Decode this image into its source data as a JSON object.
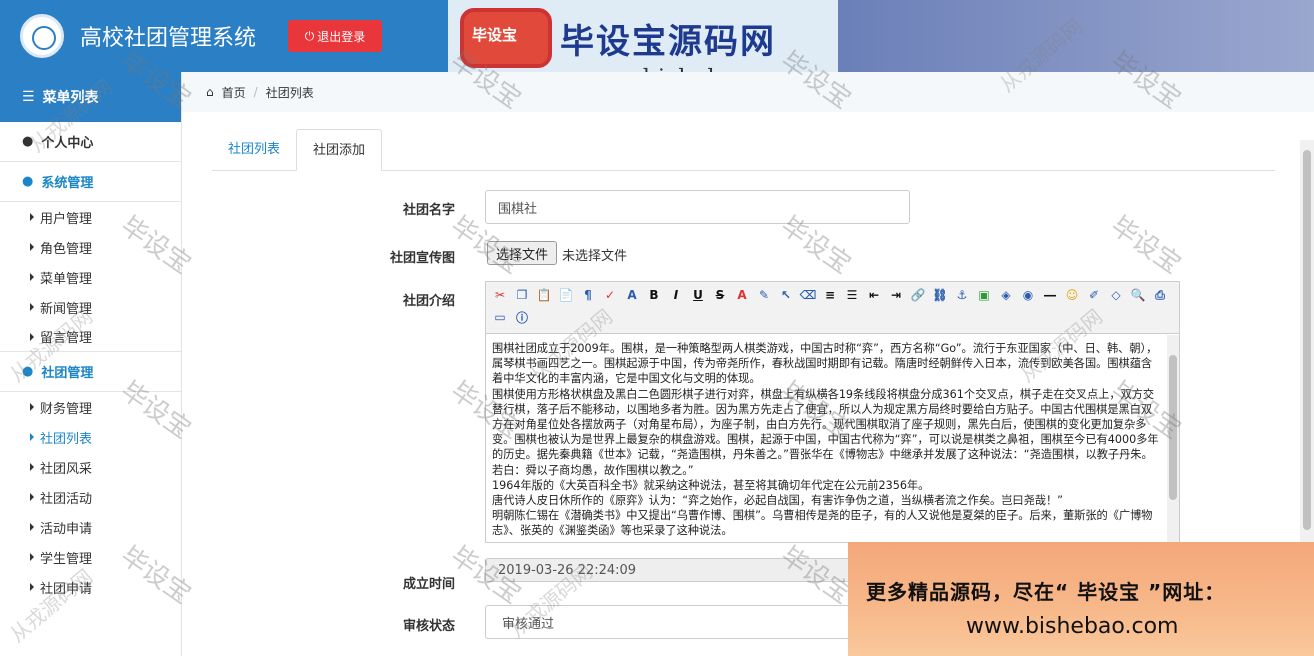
{
  "header": {
    "app_title": "高校社团管理系统",
    "logout_label": "退出登录",
    "colors": {
      "header_bg": "#2b7fc4",
      "logout_bg": "#e8363b"
    }
  },
  "banner": {
    "logo_text": "毕设宝",
    "title": "毕设宝源码网",
    "url": "www.bishebao.com"
  },
  "sidebar": {
    "menu_title": "菜单列表",
    "personal": "个人中心",
    "groups": [
      {
        "label": "系统管理",
        "items": [
          "用户管理",
          "角色管理",
          "菜单管理",
          "新闻管理",
          "留言管理"
        ]
      },
      {
        "label": "社团管理",
        "items": [
          "财务管理",
          "社团列表",
          "社团风采",
          "社团活动",
          "活动申请",
          "学生管理",
          "社团申请"
        ]
      }
    ],
    "active_item": "社团列表"
  },
  "breadcrumb": {
    "home": "首页",
    "current": "社团列表"
  },
  "tabs": [
    "社团列表",
    "社团添加"
  ],
  "active_tab": "社团添加",
  "form": {
    "name_label": "社团名字",
    "name_value": "围棋社",
    "poster_label": "社团宣传图",
    "file_button": "选择文件",
    "file_status": "未选择文件",
    "intro_label": "社团介绍",
    "intro_paragraphs": [
      "围棋社团成立于2009年。围棋，是一种策略型两人棋类游戏，中国古时称“弈”，西方名称“Go”。流行于东亚国家（中、日、韩、朝），属琴棋书画四艺之一。围棋起源于中国，传为帝尧所作，春秋战国时期即有记载。隋唐时经朝鲜传入日本，流传到欧美各国。围棋蕴含着中华文化的丰富内涵，它是中国文化与文明的体现。",
      "围棋使用方形格状棋盘及黑白二色圆形棋子进行对弈，棋盘上有纵横各19条线段将棋盘分成361个交叉点，棋子走在交叉点上，双方交替行棋，落子后不能移动，以围地多者为胜。因为黑方先走占了便宜，所以人为规定黑方局终时要给白方贴子。中国古代围棋是黑白双方在对角星位处各摆放两子（对角星布局），为座子制，由白方先行。现代围棋取消了座子规则，黑先白后，使围棋的变化更加复杂多变。围棋也被认为是世界上最复杂的棋盘游戏。围棋，起源于中国，中国古代称为“弈”，可以说是棋类之鼻祖，围棋至今已有4000多年的历史。据先秦典籍《世本》记载，“尧造围棋，丹朱善之。”晋张华在《博物志》中继承并发展了这种说法：“尧造围棋，以教子丹朱。若白：舜以子商均愚，故作围棋以教之。”",
      "1964年版的《大英百科全书》就采纳这种说法，甚至将其确切年代定在公元前2356年。",
      "唐代诗人皮日休所作的《原弈》认为：“弈之始作，必起自战国，有害诈争伪之道，当纵横者流之作矣。岂曰尧哉！”",
      "明朝陈仁锡在《潜确类书》中又提出“乌曹作博、围棋”。乌曹相传是尧的臣子，有的人又说他是夏桀的臣子。后来，董斯张的《广博物志》、张英的《渊鉴类函》等也采录了这种说法。"
    ],
    "founded_label": "成立时间",
    "founded_value": "2019-03-26 22:24:09",
    "status_label": "审核状态",
    "status_value": "审核通过"
  },
  "ad": {
    "line1": "更多精品源码，尽在“ 毕设宝 ”网址：",
    "line2": "www.bishebao.com"
  },
  "watermarks": [
    "毕设宝",
    "从戎源码网"
  ]
}
